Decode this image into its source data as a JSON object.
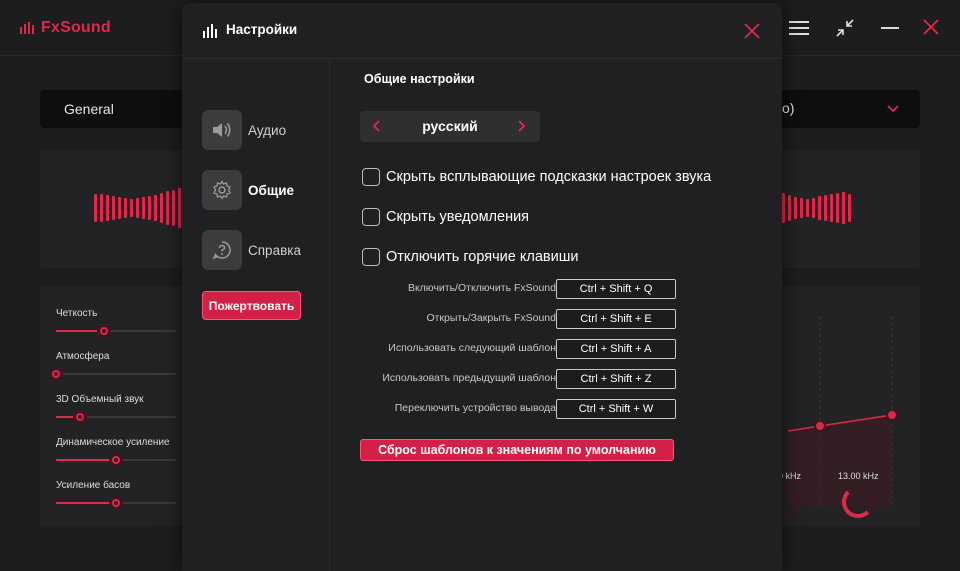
{
  "app": {
    "logo_text": "FxSound",
    "accent_color": "#e0284a"
  },
  "background": {
    "preset_label": "General",
    "preset_right_text": "o)",
    "effects": [
      {
        "label": "Четкость",
        "value": 0.4
      },
      {
        "label": "Атмосфера",
        "value": 0.0
      },
      {
        "label": "3D Объемный звук",
        "value": 0.2
      },
      {
        "label": "Динамическое усиление",
        "value": 0.5
      },
      {
        "label": "Усиление басов",
        "value": 0.5
      }
    ],
    "eq_freqs": [
      "0 kHz",
      "13.00 kHz"
    ]
  },
  "modal": {
    "title": "Настройки",
    "nav": [
      {
        "label": "Аудио",
        "icon": "speaker-icon"
      },
      {
        "label": "Общие",
        "icon": "gear-icon"
      },
      {
        "label": "Справка",
        "icon": "help-icon"
      }
    ],
    "donate_label": "Пожертвовать",
    "section_title": "Общие настройки",
    "language": "русский",
    "checks": [
      "Скрыть всплывающие подсказки настроек звука",
      "Скрыть уведомления",
      "Отключить горячие клавиши"
    ],
    "hotkeys": [
      {
        "label": "Включить/Отключить FxSound",
        "keys": "Ctrl +  Shift + Q"
      },
      {
        "label": "Открыть/Закрыть FxSound",
        "keys": "Ctrl +  Shift + E"
      },
      {
        "label": "Использовать следующий шаблон",
        "keys": "Ctrl +  Shift + A"
      },
      {
        "label": "Использовать предыдущий шаблон",
        "keys": "Ctrl +  Shift + Z"
      },
      {
        "label": "Переключить устройство вывода",
        "keys": "Ctrl +  Shift + W"
      }
    ],
    "reset_label": "Сброс шаблонов к значениям по умолчанию"
  }
}
